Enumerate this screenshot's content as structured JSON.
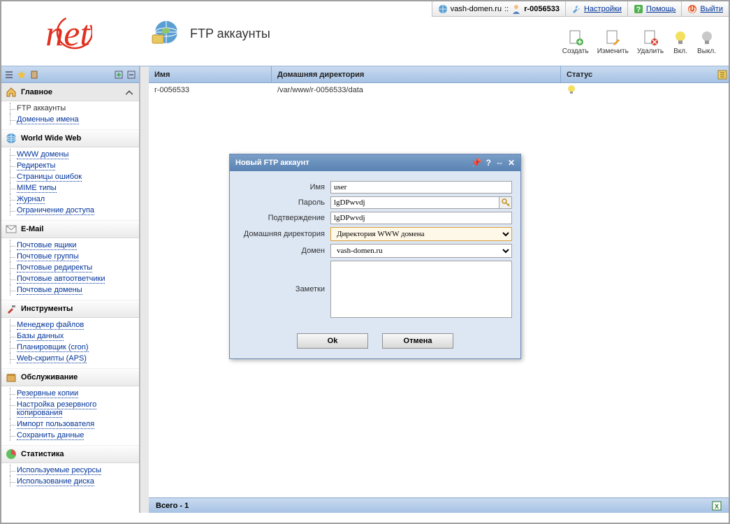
{
  "topbar": {
    "domain": "vash-domen.ru",
    "sep": "::",
    "user": "r-0056533",
    "settings": "Настройки",
    "help": "Помощь",
    "logout": "Выйти"
  },
  "page": {
    "title": "FTP аккаунты"
  },
  "toolbar": {
    "create": "Создать",
    "edit": "Изменить",
    "delete": "Удалить",
    "on": "Вкл.",
    "off": "Выкл."
  },
  "sidebar": {
    "groups": {
      "main": {
        "title": "Главное",
        "items": [
          "FTP аккаунты",
          "Доменные имена"
        ]
      },
      "www": {
        "title": "World Wide Web",
        "items": [
          "WWW домены",
          "Редиректы",
          "Страницы ошибок",
          "MIME типы",
          "Журнал",
          "Ограничение доступа"
        ]
      },
      "email": {
        "title": "E-Mail",
        "items": [
          "Почтовые ящики",
          "Почтовые группы",
          "Почтовые редиректы",
          "Почтовые автоответчики",
          "Почтовые домены"
        ]
      },
      "tools": {
        "title": "Инструменты",
        "items": [
          "Менеджер файлов",
          "Базы данных",
          "Планировщик (cron)",
          "Web-скрипты (APS)"
        ]
      },
      "maint": {
        "title": "Обслуживание",
        "items": [
          "Резервные копии",
          "Настройка резервного копирования",
          "Импорт пользователя",
          "Сохранить данные"
        ]
      },
      "stats": {
        "title": "Статистика",
        "items": [
          "Используемые ресурсы",
          "Использование диска"
        ]
      }
    }
  },
  "table": {
    "columns": {
      "name": "Имя",
      "homedir": "Домашняя директория",
      "status": "Статус"
    },
    "row": {
      "name": "r-0056533",
      "homedir": "/var/www/r-0056533/data"
    },
    "footer": "Всего - 1"
  },
  "dialog": {
    "title": "Новый FTP аккаунт",
    "labels": {
      "name": "Имя",
      "password": "Пароль",
      "confirm": "Подтверждение",
      "homedir": "Домашняя директория",
      "domain": "Домен",
      "notes": "Заметки"
    },
    "values": {
      "name": "user",
      "password": "lgDPwvdj",
      "confirm": "lgDPwvdj",
      "homedir": "Директория WWW домена",
      "domain": "vash-domen.ru"
    },
    "buttons": {
      "ok": "Ok",
      "cancel": "Отмена"
    }
  }
}
